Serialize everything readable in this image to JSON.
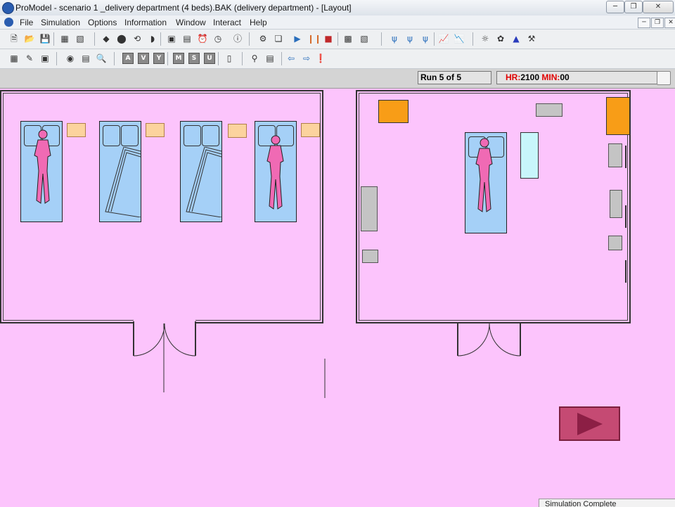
{
  "window": {
    "title": "ProModel - scenario 1 _delivery department (4 beds).BAK (delivery department) - [Layout]",
    "minimize_icon": "minimize-icon",
    "maximize_icon": "maximize-icon",
    "close_icon": "close-icon"
  },
  "menu": {
    "items": [
      "File",
      "Simulation",
      "Options",
      "Information",
      "Window",
      "Interact",
      "Help"
    ]
  },
  "toolbar2": {
    "letter_buttons": [
      "A",
      "V",
      "Y",
      "M",
      "S",
      "U"
    ]
  },
  "status": {
    "run_text": "Run 5 of 5",
    "hr_label": "HR:",
    "hr_value": "2100",
    "min_label": "MIN:",
    "min_value": "00",
    "label_color": "#e00000"
  },
  "layout": {
    "background_color": "#fcc4fc",
    "bed_color": "#a5d0f7",
    "patient_color": "#f06ab4",
    "occupied_beds_left_room": [
      true,
      false,
      false,
      true
    ],
    "occupied_beds_right_room": [
      true
    ]
  },
  "play_button": {
    "icon": "play-icon",
    "color": "#c54a73"
  },
  "popup": {
    "text": "Simulation Complete"
  }
}
